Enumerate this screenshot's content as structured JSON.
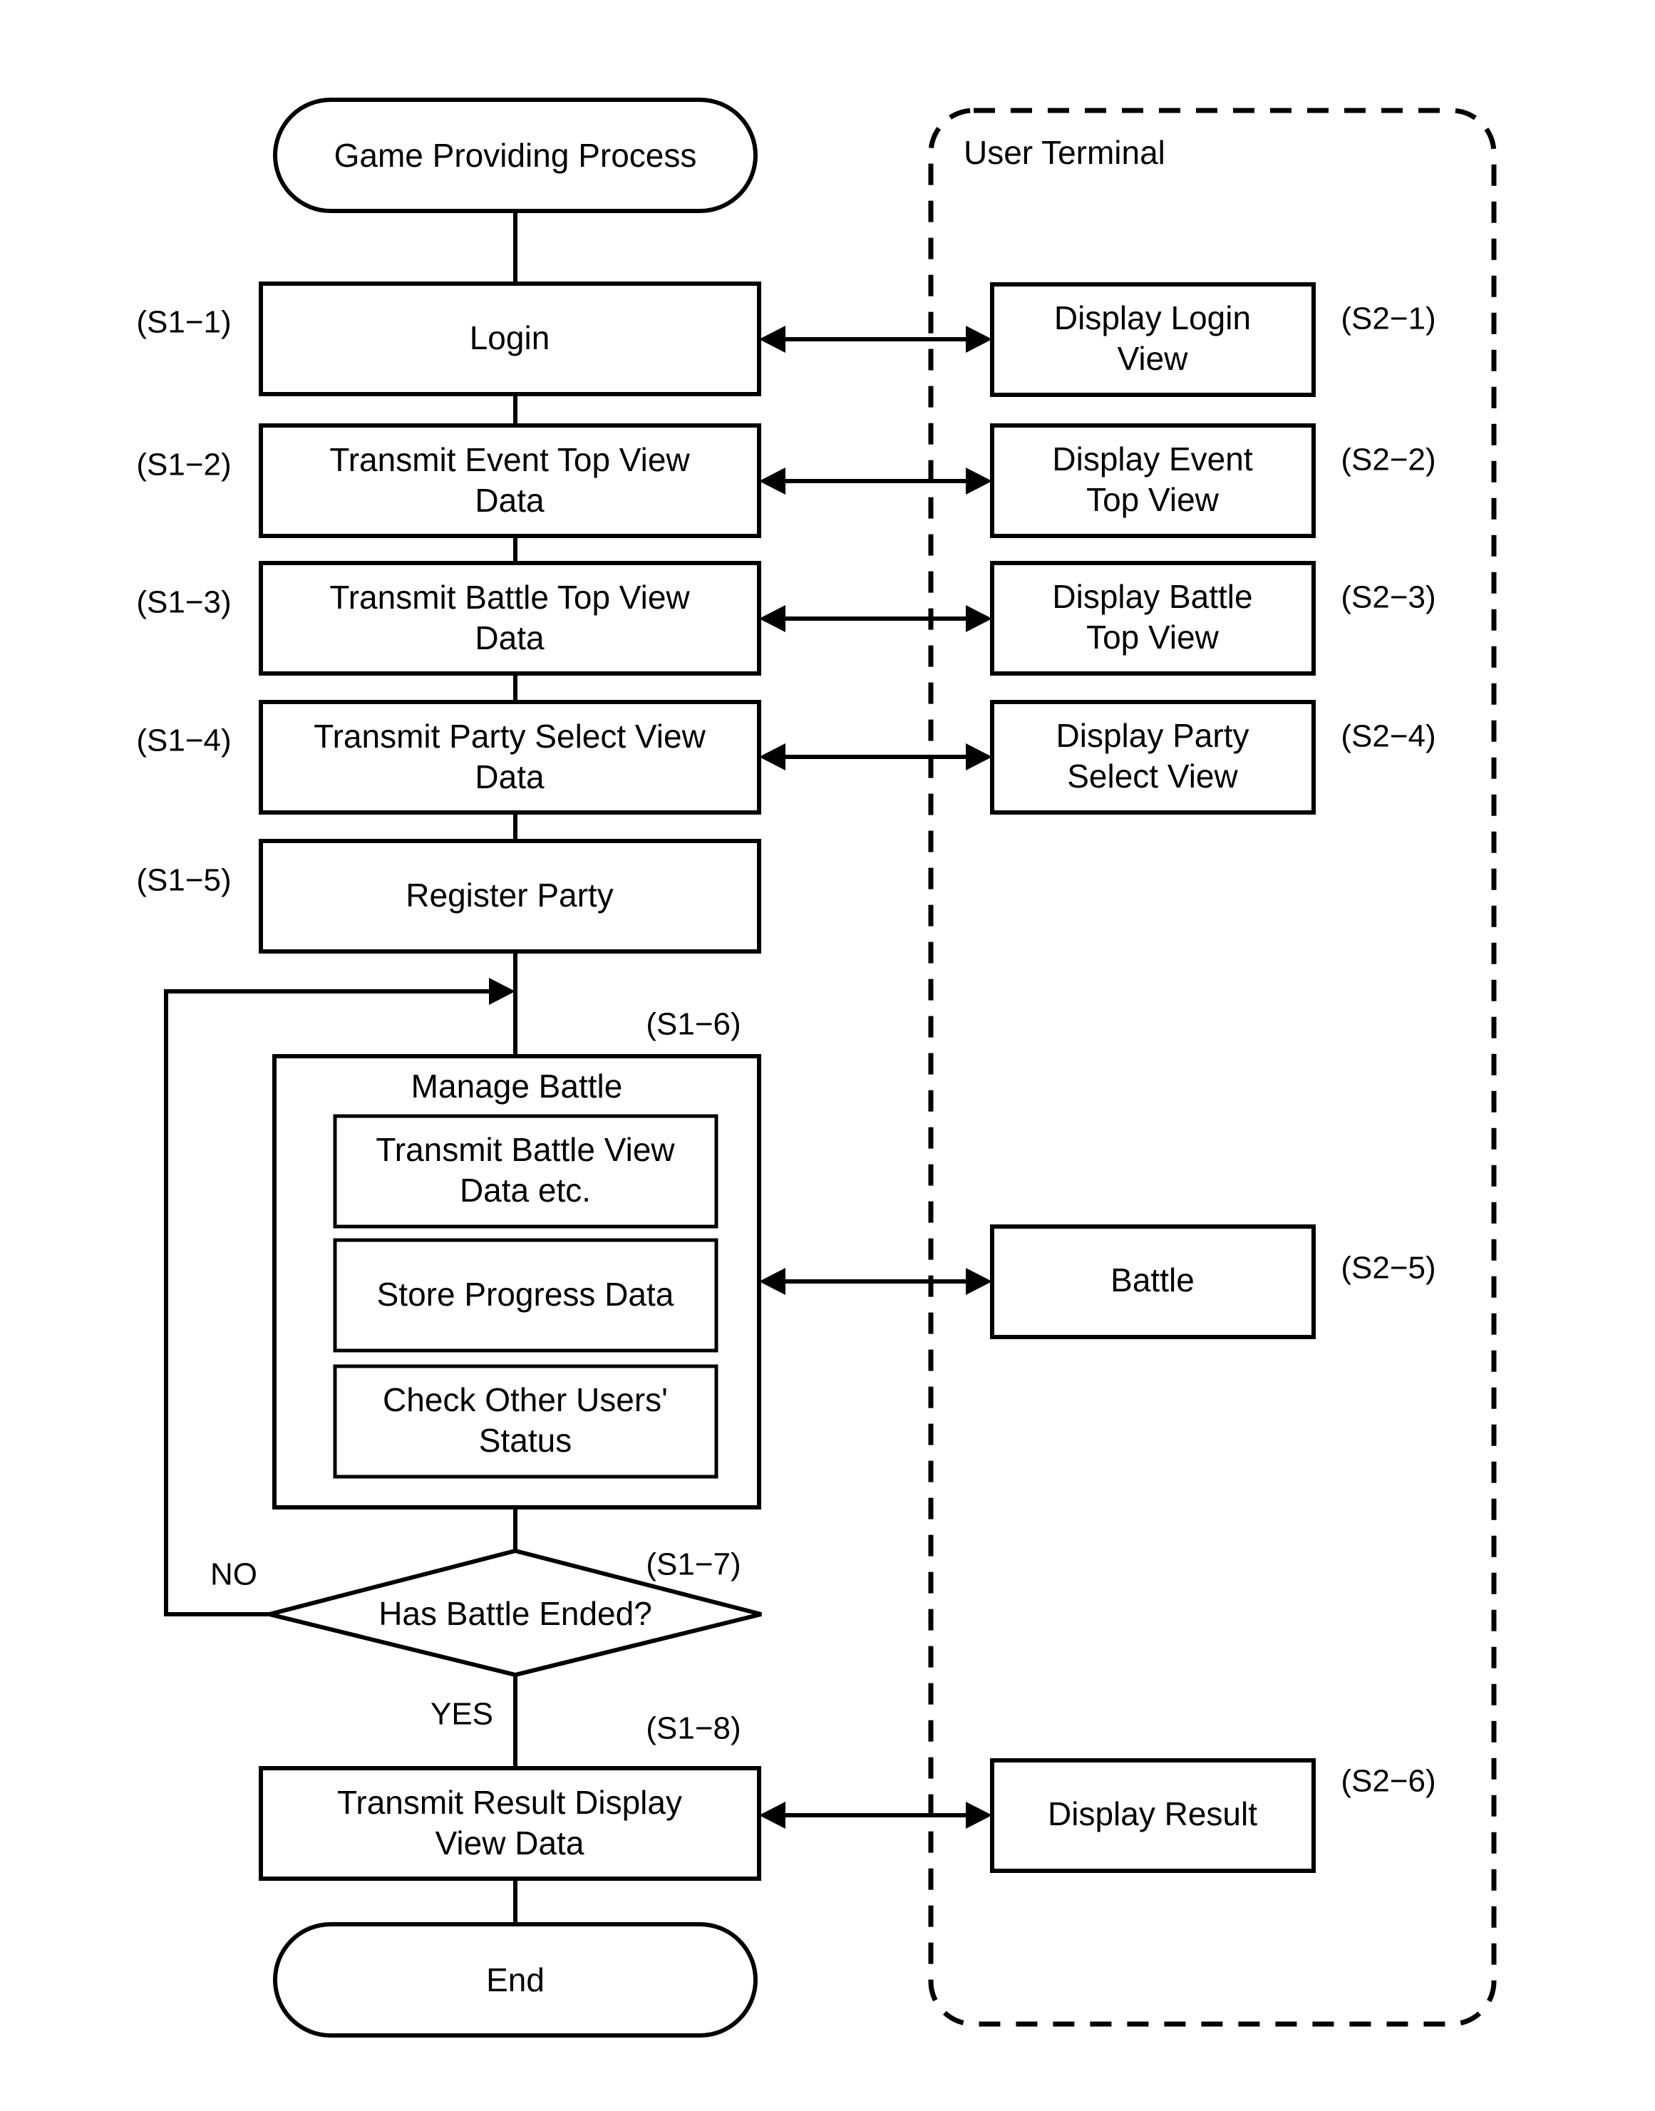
{
  "diagram": {
    "type": "flowchart",
    "title_node": "Game Providing Process",
    "end_node": "End",
    "lane_label": "User Terminal"
  },
  "server_steps": [
    {
      "id": "S1-1",
      "step_label": "(S1−1)",
      "text": "Login"
    },
    {
      "id": "S1-2",
      "step_label": "(S1−2)",
      "text": "Transmit Event Top View Data"
    },
    {
      "id": "S1-3",
      "step_label": "(S1−3)",
      "text": "Transmit Battle Top View Data"
    },
    {
      "id": "S1-4",
      "step_label": "(S1−4)",
      "text": "Transmit Party Select View Data"
    },
    {
      "id": "S1-5",
      "step_label": "(S1−5)",
      "text": "Register Party"
    },
    {
      "id": "S1-6",
      "step_label": "(S1−6)",
      "text": "Manage Battle"
    },
    {
      "id": "S1-7",
      "step_label": "(S1−7)",
      "text": "Has Battle Ended?"
    },
    {
      "id": "S1-8",
      "step_label": "(S1−8)",
      "text": "Transmit Result Display View Data"
    }
  ],
  "manage_battle_substeps": [
    {
      "text": "Transmit Battle View Data etc."
    },
    {
      "text": "Store Progress Data"
    },
    {
      "text": "Check Other Users' Status"
    }
  ],
  "terminal_steps": [
    {
      "id": "S2-1",
      "step_label": "(S2−1)",
      "text": "Display Login View"
    },
    {
      "id": "S2-2",
      "step_label": "(S2−2)",
      "text": "Display Event Top View"
    },
    {
      "id": "S2-3",
      "step_label": "(S2−3)",
      "text": "Display Battle Top View"
    },
    {
      "id": "S2-4",
      "step_label": "(S2−4)",
      "text": "Display Party Select View"
    },
    {
      "id": "S2-5",
      "step_label": "(S2−5)",
      "text": "Battle"
    },
    {
      "id": "S2-6",
      "step_label": "(S2−6)",
      "text": "Display Result"
    }
  ],
  "branches": {
    "no": "NO",
    "yes": "YES"
  },
  "text_lines": {
    "s1_1": [
      "Login"
    ],
    "s1_2": [
      "Transmit Event Top View",
      "Data"
    ],
    "s1_3": [
      "Transmit Battle Top View",
      "Data"
    ],
    "s1_4": [
      "Transmit Party Select View",
      "Data"
    ],
    "s1_5": [
      "Register Party"
    ],
    "s1_6": [
      "Manage Battle"
    ],
    "s1_7": [
      "Has Battle Ended?"
    ],
    "s1_8": [
      "Transmit Result Display",
      "View Data"
    ],
    "sub_1": [
      "Transmit Battle View",
      "Data etc."
    ],
    "sub_2": [
      "Store Progress Data"
    ],
    "sub_3": [
      "Check Other Users'",
      "Status"
    ],
    "s2_1": [
      "Display Login",
      "View"
    ],
    "s2_2": [
      "Display Event",
      "Top View"
    ],
    "s2_3": [
      "Display Battle",
      "Top View"
    ],
    "s2_4": [
      "Display Party",
      "Select View"
    ],
    "s2_5": [
      "Battle"
    ],
    "s2_6": [
      "Display Result"
    ],
    "start": [
      "Game Providing Process"
    ],
    "end": [
      "End"
    ]
  },
  "colors": {
    "stroke": "#000000",
    "fill": "#ffffff"
  }
}
